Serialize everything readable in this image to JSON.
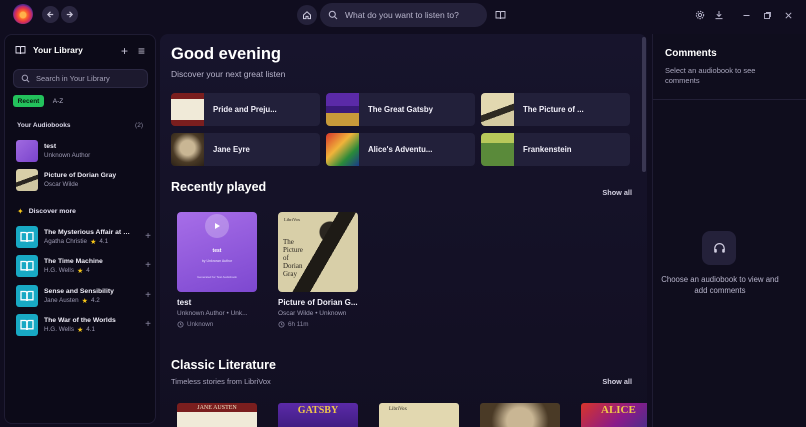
{
  "topbar": {
    "search_placeholder": "What do you want to listen to?",
    "icons": [
      "back-icon",
      "forward-icon",
      "home-icon",
      "search-icon",
      "book-icon",
      "settings-icon",
      "download-icon",
      "minimize-icon",
      "maximize-icon",
      "close-icon"
    ]
  },
  "sidebar": {
    "title": "Your Library",
    "search_placeholder": "Search in Your Library",
    "filters": [
      "Recent",
      "A-Z"
    ],
    "audiobooks_label": "Your Audiobooks",
    "audiobooks_count": "(2)",
    "audiobooks": [
      {
        "title": "test",
        "author": "Unknown Author"
      },
      {
        "title": "Picture of Dorian Gray",
        "author": "Oscar Wilde"
      }
    ],
    "discover_label": "Discover more",
    "discover": [
      {
        "title": "The Mysterious Affair at Styles",
        "author": "Agatha Christie",
        "rating": "4.1"
      },
      {
        "title": "The Time Machine",
        "author": "H.G. Wells",
        "rating": "4"
      },
      {
        "title": "Sense and Sensibility",
        "author": "Jane Austen",
        "rating": "4.2"
      },
      {
        "title": "The War of the Worlds",
        "author": "H.G. Wells",
        "rating": "4.1"
      }
    ]
  },
  "main": {
    "greeting": "Good evening",
    "greeting_sub": "Discover your next great listen",
    "quick": [
      {
        "label": "Pride and Preju..."
      },
      {
        "label": "The Great Gatsby"
      },
      {
        "label": "The Picture of ..."
      },
      {
        "label": "Jane Eyre"
      },
      {
        "label": "Alice's Adventu..."
      },
      {
        "label": "Frankenstein"
      }
    ],
    "recent_title": "Recently played",
    "show_all": "Show all",
    "recent": [
      {
        "title": "test",
        "sub": "Unknown Author • Unk...",
        "meta": "Unknown",
        "cover_title": "test",
        "cover_by": "by Unknown Author",
        "cover_note": "Generated for Test Audiobook"
      },
      {
        "title": "Picture of Dorian G...",
        "sub": "Oscar Wilde • Unknown",
        "meta": "6h 11m",
        "cover_brand": "LibriVox",
        "cover_lines": [
          "The",
          "Picture",
          "of",
          "Dorian",
          "Gray"
        ]
      }
    ],
    "classic_title": "Classic Literature",
    "classic_sub": "Timeless stories from LibriVox",
    "classic_show_all": "Show all",
    "classic_covers": [
      {
        "text": "JANE AUSTEN"
      },
      {
        "text": "GATSBY"
      },
      {
        "text": "LibriVox"
      },
      {
        "text": ""
      },
      {
        "text": "ALICE"
      }
    ]
  },
  "comments": {
    "title": "Comments",
    "subtitle": "Select an audiobook to see comments",
    "empty": "Choose an audiobook to view and add comments"
  }
}
